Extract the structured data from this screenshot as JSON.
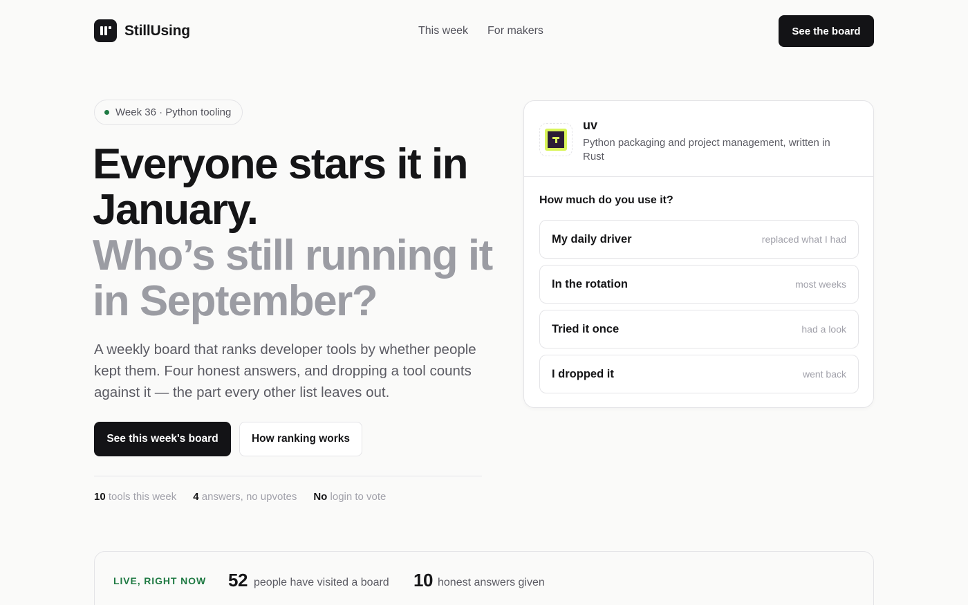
{
  "header": {
    "brand": "StillUsing",
    "nav": [
      "This week",
      "For makers"
    ],
    "cta_label": "See the board"
  },
  "hero": {
    "badge": "Week 36 · Python tooling",
    "headline_dark": "Everyone stars it in January.",
    "headline_muted": "Who’s still running it in September?",
    "lede": "A weekly board that ranks developer tools by whether people kept them. Four honest answers, and dropping a tool counts against it — the part every other list leaves out.",
    "primary_label": "See this week's board",
    "secondary_label": "How ranking works",
    "stats": [
      {
        "value": "10",
        "label": "tools this week"
      },
      {
        "value": "4",
        "label": "answers, no upvotes"
      },
      {
        "value": "No",
        "label": "login to vote"
      }
    ]
  },
  "card": {
    "tool_name": "uv",
    "tool_desc": "Python packaging and project management, written in Rust",
    "question": "How much do you use it?",
    "options": [
      {
        "label": "My daily driver",
        "hint": "replaced what I had"
      },
      {
        "label": "In the rotation",
        "hint": "most weeks"
      },
      {
        "label": "Tried it once",
        "hint": "had a look"
      },
      {
        "label": "I dropped it",
        "hint": "went back"
      }
    ]
  },
  "live": {
    "tag": "LIVE, RIGHT NOW",
    "visitors_value": "52",
    "visitors_label": "people have visited a board",
    "answers_value": "10",
    "answers_label": "honest answers given"
  },
  "colors": {
    "accent_green": "#1f7a43",
    "dark": "#131316",
    "muted_headline": "#9b9ca3",
    "uv_icon_lime": "#d9f55a",
    "uv_icon_purple": "#2b1d35"
  }
}
